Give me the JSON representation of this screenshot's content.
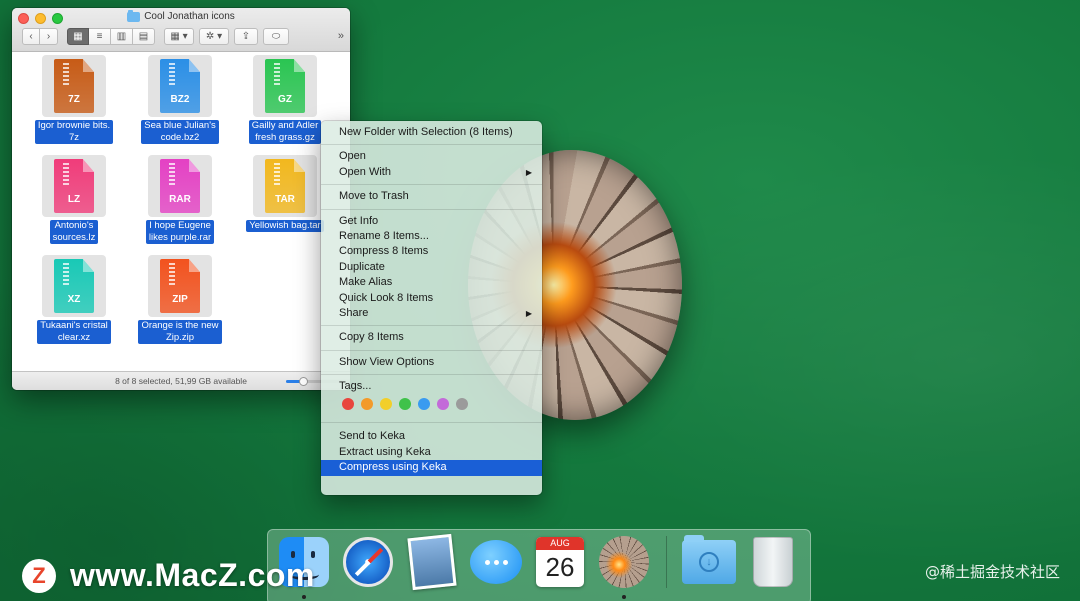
{
  "finder": {
    "title": "Cool Jonathan icons",
    "toolbar": {
      "back": "‹",
      "forward": "›",
      "view_icon": "▦",
      "view_list": "≡",
      "view_columns": "▥",
      "view_gallery": "▤",
      "arrange": "▦ ▾",
      "action": "✲ ▾",
      "share": "⇪",
      "tags": "⬭",
      "more": "»"
    },
    "files": [
      {
        "ext": "7Z",
        "label": "Igor brownie bits.\n7z",
        "color": "#c75b16"
      },
      {
        "ext": "BZ2",
        "label": "Sea blue Julian's\ncode.bz2",
        "color": "#2b8fe6"
      },
      {
        "ext": "GZ",
        "label": "Gailly and Adler\nfresh grass.gz",
        "color": "#2ac552"
      },
      {
        "ext": "LZ",
        "label": "Antonio's\nsources.lz",
        "color": "#f03c7a"
      },
      {
        "ext": "RAR",
        "label": "I hope Eugene\nlikes purple.rar",
        "color": "#e441c4"
      },
      {
        "ext": "TAR",
        "label": "Yellowish bag.tar",
        "color": "#f2b81e"
      },
      {
        "ext": "XZ",
        "label": "Tukaani's cristal\nclear.xz",
        "color": "#19c9b6"
      },
      {
        "ext": "ZIP",
        "label": "Orange is the new\nZip.zip",
        "color": "#f2521e"
      }
    ],
    "status": "8 of 8 selected, 51,99 GB available",
    "zoom_level": 0.3
  },
  "context_menu": {
    "new_folder": "New Folder with Selection (8 Items)",
    "open": "Open",
    "open_with": "Open With",
    "move_to_trash": "Move to Trash",
    "get_info": "Get Info",
    "rename": "Rename 8 Items...",
    "compress": "Compress 8 Items",
    "duplicate": "Duplicate",
    "make_alias": "Make Alias",
    "quick_look": "Quick Look 8 Items",
    "share": "Share",
    "copy": "Copy 8 Items",
    "show_view_options": "Show View Options",
    "tags": "Tags...",
    "tag_colors": [
      "#e8463e",
      "#f39a2a",
      "#f2cf2a",
      "#3fc24a",
      "#3a9bf0",
      "#c36ad9",
      "#9b9b9b"
    ],
    "send_to_keka": "Send to Keka",
    "extract_keka": "Extract using Keka",
    "compress_keka": "Compress using Keka"
  },
  "dock": {
    "calendar_month": "AUG",
    "calendar_day": "26"
  },
  "watermark": {
    "badge": "Z",
    "left_text": "www.MacZ.com",
    "right_text": "@稀土掘金技术社区"
  }
}
